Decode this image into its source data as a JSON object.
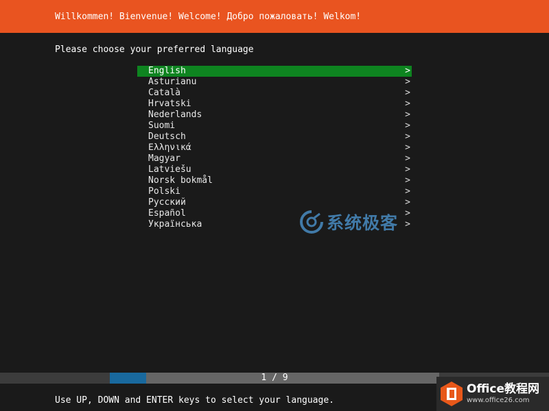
{
  "header": {
    "title": "Willkommen! Bienvenue! Welcome! Добро пожаловать! Welkom!"
  },
  "prompt": {
    "text": "Please choose your preferred language"
  },
  "languages": {
    "selected_index": 0,
    "items": [
      {
        "label": "English",
        "has_submenu": true
      },
      {
        "label": "Asturianu",
        "has_submenu": true
      },
      {
        "label": "Català",
        "has_submenu": true
      },
      {
        "label": "Hrvatski",
        "has_submenu": true
      },
      {
        "label": "Nederlands",
        "has_submenu": true
      },
      {
        "label": "Suomi",
        "has_submenu": true
      },
      {
        "label": "Deutsch",
        "has_submenu": true
      },
      {
        "label": "Ελληνικά",
        "has_submenu": true
      },
      {
        "label": "Magyar",
        "has_submenu": true
      },
      {
        "label": "Latviešu",
        "has_submenu": true
      },
      {
        "label": "Norsk bokmål",
        "has_submenu": true
      },
      {
        "label": "Polski",
        "has_submenu": true
      },
      {
        "label": "Русский",
        "has_submenu": true
      },
      {
        "label": "Español",
        "has_submenu": true
      },
      {
        "label": "Українська",
        "has_submenu": true
      }
    ],
    "chevron": ">"
  },
  "progress": {
    "label": "1 / 9",
    "current_step": 1,
    "total_steps": 9
  },
  "footer": {
    "hint": "Use UP, DOWN and ENTER keys to select your language."
  },
  "watermarks": {
    "center_text": "系统极客",
    "office_brand": "Office教程网",
    "office_url": "www.office26.com"
  },
  "colors": {
    "header": "#e95420",
    "background": "#1a1a1a",
    "selected_row": "#0e8420",
    "progress_fill": "#19699e",
    "progress_track": "#666666"
  }
}
